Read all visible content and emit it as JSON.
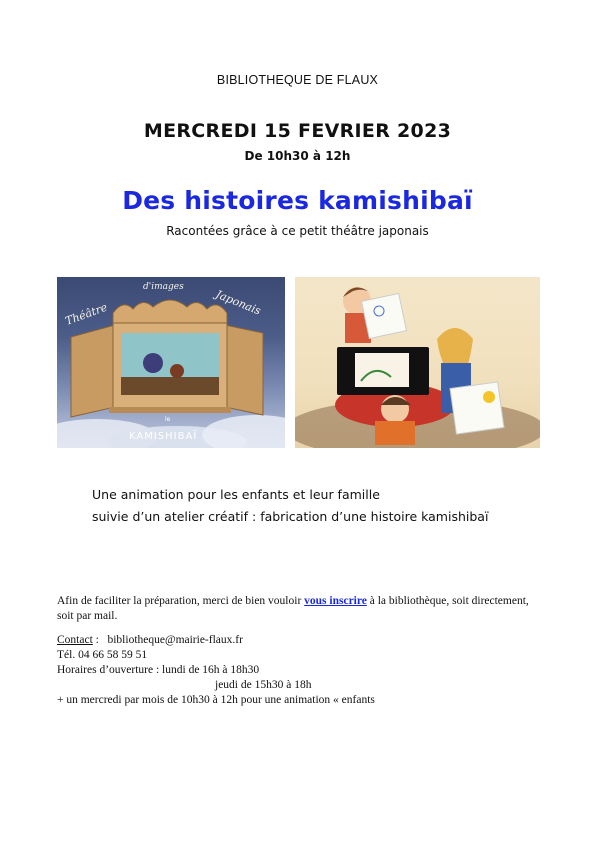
{
  "header": {
    "library": "BIBLIOTHEQUE DE FLAUX",
    "date": "MERCREDI 15 FEVRIER 2023",
    "time": "De 10h30 à 12h"
  },
  "event": {
    "title": "Des histoires kamishibaï",
    "subtitle": "Racontées grâce à ce petit théâtre japonais"
  },
  "images": {
    "theatre": {
      "arc_word1": "Théâtre",
      "arc_word2": "d'images",
      "arc_word3": "Japonais",
      "bottom_le": "le",
      "bottom_name": "KAMISHIBAÏ"
    }
  },
  "description": {
    "line1": "Une animation pour les enfants et leur famille",
    "line2": "suivie d’un atelier créatif : fabrication d’une histoire kamishibaï"
  },
  "registration": {
    "before": "Afin de faciliter la préparation, merci de bien vouloir ",
    "link": "vous inscrire",
    "after": " à la bibliothèque, soit directement, soit par mail."
  },
  "contact": {
    "label": "Contact",
    "sep": " :   ",
    "email": "bibliotheque@mairie-flaux.fr",
    "phone": "Tél. 04 66 58 59 51",
    "hours_line1": "Horaires d’ouverture : lundi de 16h à 18h30",
    "hours_line2": "jeudi de 15h30 à 18h",
    "hours_line3": "+ un mercredi par mois de 10h30 à 12h pour une animation « enfants"
  }
}
